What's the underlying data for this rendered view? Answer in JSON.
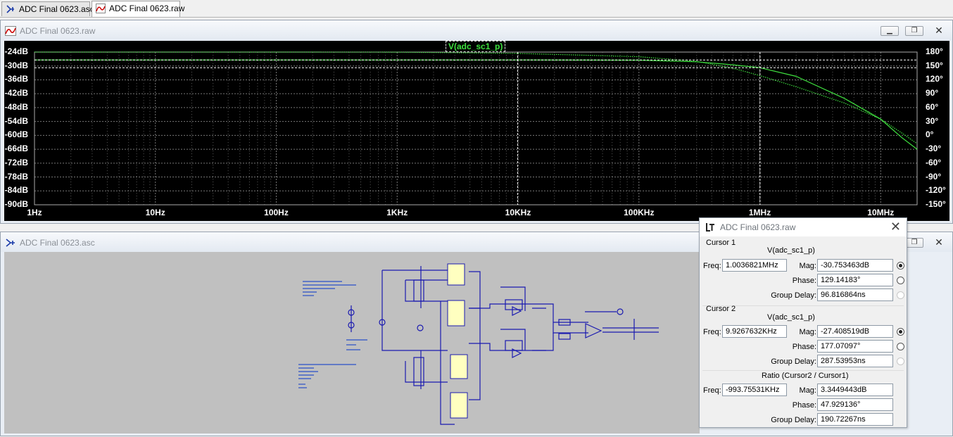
{
  "tabs": [
    {
      "label": "ADC Final 0623.asc",
      "icon": "schematic-icon",
      "active": false
    },
    {
      "label": "ADC Final 0623.raw",
      "icon": "waveform-icon",
      "active": true
    }
  ],
  "plot_window": {
    "title": "ADC Final 0623.raw",
    "trace_label": "V(adc_sc1_p)"
  },
  "schematic_window": {
    "title": "ADC Final 0623.asc"
  },
  "colors": {
    "trace": "#3fe13f",
    "plot_bg": "#000000",
    "schematic_bg": "#c0c0c0",
    "wire": "#1a1ab0",
    "component": "#ffffc0"
  },
  "chart_data": {
    "type": "line",
    "x_scale": "log",
    "xlim": [
      1,
      20000000
    ],
    "x_ticks": [
      "1Hz",
      "10Hz",
      "100Hz",
      "1KHz",
      "10KHz",
      "100KHz",
      "1MHz",
      "10MHz"
    ],
    "ylim_left": [
      -90,
      -24
    ],
    "y_ticks_left": [
      "-24dB",
      "-30dB",
      "-36dB",
      "-42dB",
      "-48dB",
      "-54dB",
      "-60dB",
      "-66dB",
      "-72dB",
      "-78dB",
      "-84dB",
      "-90dB"
    ],
    "ylim_right": [
      -150,
      180
    ],
    "y_ticks_right": [
      "180°",
      "150°",
      "120°",
      "90°",
      "60°",
      "30°",
      "0°",
      "-30°",
      "-60°",
      "-90°",
      "-120°",
      "-150°"
    ],
    "grid": true,
    "series": [
      {
        "name": "V(adc_sc1_p)",
        "axis": "left",
        "style": "solid",
        "x": [
          1,
          100,
          10000,
          100000,
          300000,
          600000,
          1000000,
          2000000,
          5000000,
          10000000,
          15000000,
          20000000
        ],
        "y": [
          -27.4,
          -27.4,
          -27.41,
          -27.5,
          -28.2,
          -29.5,
          -30.75,
          -34.5,
          -44.0,
          -53.0,
          -61.0,
          -66.0
        ]
      },
      {
        "name": "V(adc_sc1_p)",
        "axis": "right",
        "style": "dotted",
        "x": [
          1,
          100,
          1000,
          10000,
          100000,
          300000,
          600000,
          1000000,
          2000000,
          5000000,
          10000000,
          15000000,
          20000000
        ],
        "y": [
          180,
          180,
          179.8,
          177.07,
          170,
          160,
          145,
          129.14,
          105,
          70,
          35,
          5,
          -18
        ]
      }
    ],
    "cursor1_x": 1003682.1,
    "cursor2_x": 9926.7632
  },
  "cursor_dialog": {
    "title": "ADC Final 0623.raw",
    "cursor1": {
      "heading": "Cursor 1",
      "trace": "V(adc_sc1_p)",
      "freq_label": "Freq:",
      "freq": "1.0036821MHz",
      "mag_label": "Mag:",
      "mag": "-30.753463dB",
      "phase_label": "Phase:",
      "phase": "129.14183°",
      "gd_label": "Group Delay:",
      "gd": "96.816864ns"
    },
    "cursor2": {
      "heading": "Cursor 2",
      "trace": "V(adc_sc1_p)",
      "freq_label": "Freq:",
      "freq": "9.9267632KHz",
      "mag_label": "Mag:",
      "mag": "-27.408519dB",
      "phase_label": "Phase:",
      "phase": "177.07097°",
      "gd_label": "Group Delay:",
      "gd": "287.53953ns"
    },
    "ratio": {
      "heading": "Ratio (Cursor2 / Cursor1)",
      "freq_label": "Freq:",
      "freq": "-993.75531KHz",
      "mag_label": "Mag:",
      "mag": "3.3449443dB",
      "phase_label": "Phase:",
      "phase": "47.929136°",
      "gd_label": "Group Delay:",
      "gd": "190.72267ns"
    }
  }
}
